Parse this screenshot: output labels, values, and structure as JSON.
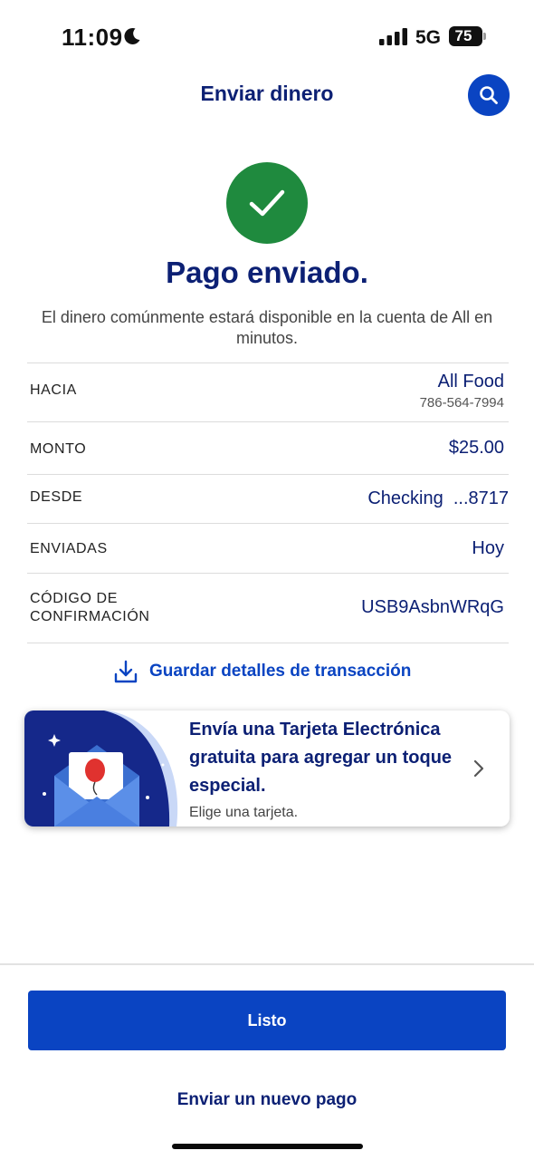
{
  "status_bar": {
    "time": "11:09",
    "network": "5G",
    "battery": "75"
  },
  "header": {
    "title": "Enviar dinero"
  },
  "success": {
    "title": "Pago enviado.",
    "subtitle": "El dinero comúnmente estará disponible en la cuenta de All en minutos.",
    "color": "#1f8a3e"
  },
  "details": {
    "to_label": "HACIA",
    "to_name": "All Food",
    "to_phone": "786-564-7994",
    "amount_label": "MONTO",
    "amount_value": "$25.00",
    "from_label": "DESDE",
    "from_value": "Checking  ...8717",
    "sent_label": "ENVIADAS",
    "sent_value": "Hoy",
    "confirmation_label": "CÓDIGO DE CONFIRMACIÓN",
    "confirmation_value": "USB9AsbnWRqG"
  },
  "save_details": {
    "label": "Guardar detalles de transacción"
  },
  "promo": {
    "title": "Envía una Tarjeta Electrónica gratuita para agregar un toque especial.",
    "subtitle": "Elige una tarjeta."
  },
  "footer": {
    "done_label": "Listo",
    "new_payment_label": "Enviar un nuevo pago"
  },
  "colors": {
    "brand_navy": "#0c2074",
    "brand_blue": "#0a44c2",
    "success_green": "#1f8a3e"
  },
  "icons": [
    "moon-icon",
    "signal-icon",
    "battery-icon",
    "search-icon",
    "checkmark-icon",
    "download-icon",
    "envelope-card-icon",
    "chevron-right-icon"
  ]
}
